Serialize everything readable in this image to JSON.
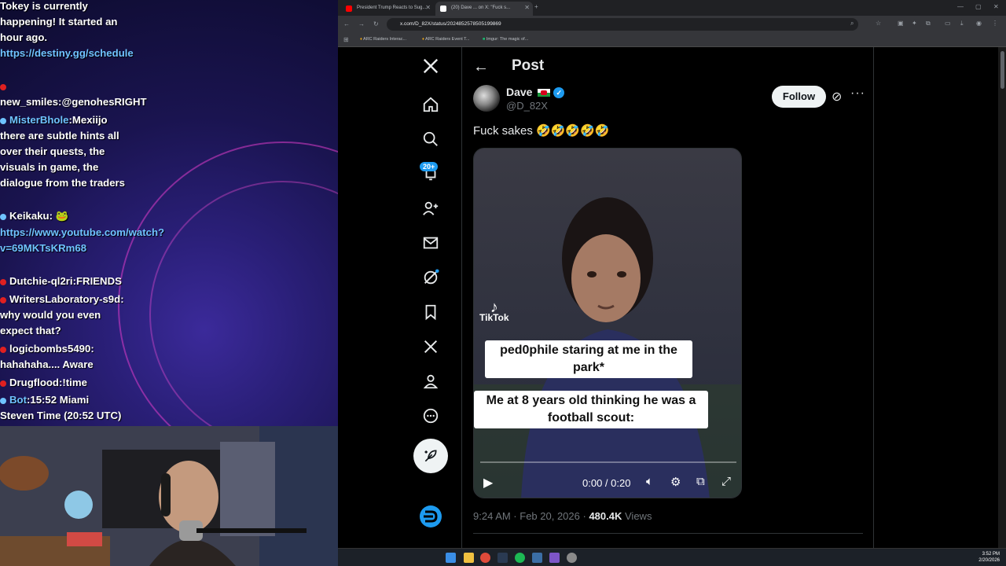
{
  "chat": {
    "lines": [
      {
        "user": "",
        "text": "Tokey is currently happening! It started an hour ago.",
        "color": ""
      },
      {
        "user": "",
        "text": "https://destiny.gg/schedule",
        "color": "#6fc3ff"
      },
      {
        "user": "new_smiles",
        "text": ":@genohesRIGHT",
        "color": "#ff3b3b"
      },
      {
        "user": "MisterBhole",
        "text": ":Mexiijo there are subtle hints all over their quests, the visuals in game, the dialogue from the traders",
        "color": "#6fc3ff"
      },
      {
        "user": "Keikaku",
        "text": ": ",
        "color": "#6fc3ff"
      },
      {
        "user": "",
        "text": "https://www.youtube.com/watch?v=69MKTsKRm68",
        "color": "#6fc3ff"
      },
      {
        "user": "Dutchie-ql2ri",
        "text": ":FRIENDS",
        "color": "#ff3b3b"
      },
      {
        "user": "WritersLaboratory-s9d",
        "text": ": why would you even expect that?",
        "color": "#ff3b3b"
      },
      {
        "user": "logicbombs5490",
        "text": ": hahahaha.... Aware",
        "color": "#ff3b3b"
      },
      {
        "user": "Drugflood",
        "text": ":!time",
        "color": "#ff3b3b"
      },
      {
        "user": "Bot",
        "text": ":15:52 Miami Steven Time (20:52 UTC)",
        "color": "#6fc3ff"
      }
    ]
  },
  "browser": {
    "tabs": [
      {
        "label": "President Trump Reacts to Sug...",
        "active": false,
        "icon_color": "#ff0000"
      },
      {
        "label": "(20) Dave ... on X: \"Fuck s...",
        "active": true,
        "icon_color": "#ffffff"
      }
    ],
    "url": "x.com/D_82X/status/2024852578505199869",
    "bookmarks": [
      "ARC Raiders Interac...",
      "ARC Raiders Event T...",
      "Imgur: The magic of..."
    ]
  },
  "nav": {
    "notification_badge": "20+"
  },
  "post": {
    "header": "Post",
    "display_name": "Dave",
    "handle": "@D_82X",
    "follow_label": "Follow",
    "text": "Fuck sakes 🤣🤣🤣🤣🤣",
    "caption_top": "ped0phile staring at me in the park*",
    "caption_bottom": "Me at 8 years old thinking he was a football scout:",
    "tiktok_label": "TikTok",
    "video_time": "0:00 / 0:20",
    "timestamp": "9:24 AM · Feb 20, 2026",
    "views_count": "480.4K",
    "views_label": "Views"
  },
  "taskbar": {
    "time": "3:52 PM",
    "date": "2/20/2026"
  },
  "colors": {
    "accent_blue": "#1d9bf0",
    "x_black": "#000000",
    "chat_link": "#6fc3ff"
  }
}
